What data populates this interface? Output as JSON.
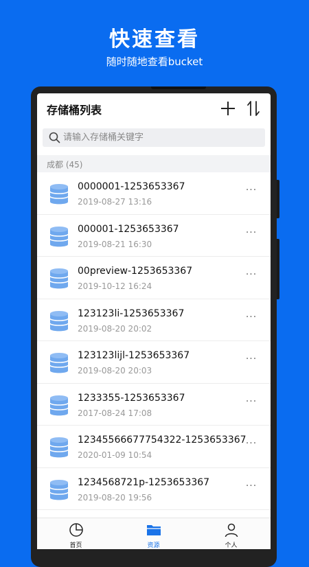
{
  "promo": {
    "title": "快速查看",
    "subtitle": "随时随地查看bucket"
  },
  "navbar": {
    "title": "存储桶列表",
    "add_icon": "plus-icon",
    "sort_icon": "sort-icon"
  },
  "search": {
    "placeholder": "请输入存储桶关键字",
    "value": ""
  },
  "group": {
    "label": "成都 (45)"
  },
  "buckets": [
    {
      "name": "0000001-1253653367",
      "date": "2019-08-27 13:16"
    },
    {
      "name": "000001-1253653367",
      "date": "2019-08-21 16:30"
    },
    {
      "name": "00preview-1253653367",
      "date": "2019-10-12 16:24"
    },
    {
      "name": "123123li-1253653367",
      "date": "2019-08-20 20:02"
    },
    {
      "name": "123123lijl-1253653367",
      "date": "2019-08-20 20:03"
    },
    {
      "name": "1233355-1253653367",
      "date": "2017-08-24 17:08"
    },
    {
      "name": "12345566677754322-1253653367",
      "date": "2020-01-09 10:54"
    },
    {
      "name": "1234568721p-1253653367",
      "date": "2019-08-20 19:56"
    }
  ],
  "more_glyph": "···",
  "tabs": [
    {
      "label": "首页",
      "icon": "pie-chart-icon",
      "active": false
    },
    {
      "label": "资源",
      "icon": "folder-icon",
      "active": true
    },
    {
      "label": "个人",
      "icon": "user-icon",
      "active": false
    }
  ],
  "colors": {
    "background": "#0a6cf0",
    "accent": "#1a73e8",
    "database_icon": "#6fa8ee"
  }
}
